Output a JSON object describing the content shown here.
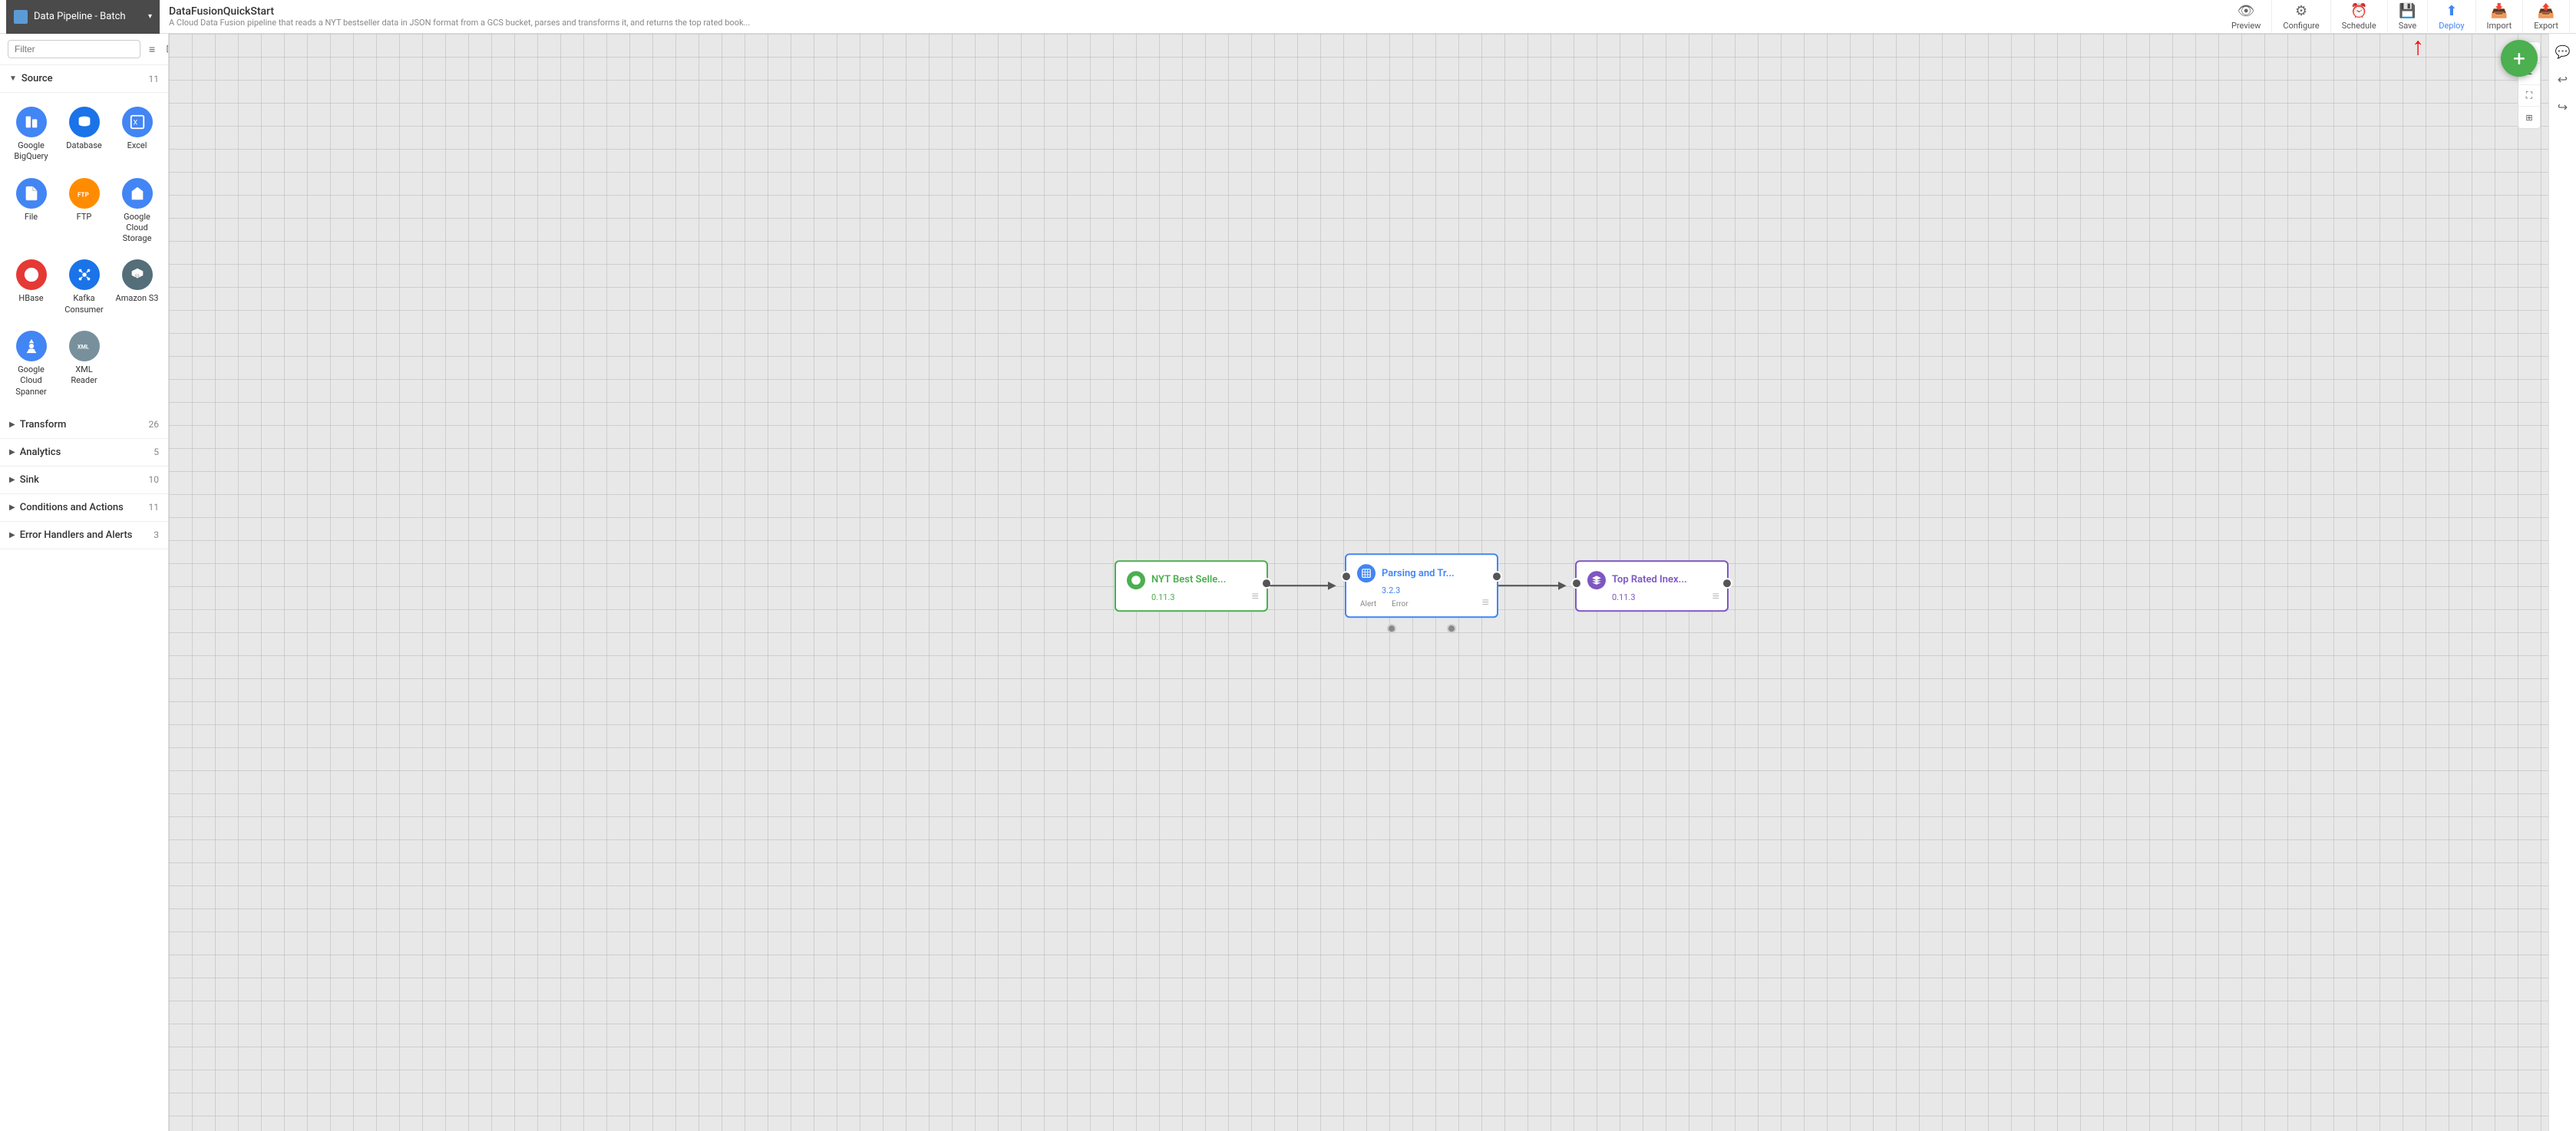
{
  "topbar": {
    "pipeline_selector": {
      "label": "Data Pipeline - Batch",
      "arrow": "▾"
    },
    "app_title": "DataFusionQuickStart",
    "app_desc": "A Cloud Data Fusion pipeline that reads a NYT bestseller data in JSON format from a GCS bucket, parses and transforms it, and returns the top rated book...",
    "toolbar_buttons": [
      {
        "id": "preview",
        "icon": "👁",
        "label": "Preview"
      },
      {
        "id": "configure",
        "icon": "⚙",
        "label": "Configure"
      },
      {
        "id": "schedule",
        "icon": "⏰",
        "label": "Schedule"
      },
      {
        "id": "save",
        "icon": "💾",
        "label": "Save"
      },
      {
        "id": "deploy",
        "icon": "⬆",
        "label": "Deploy"
      },
      {
        "id": "import",
        "icon": "📥",
        "label": "Import"
      },
      {
        "id": "export",
        "icon": "📤",
        "label": "Export"
      }
    ]
  },
  "sidebar": {
    "filter_placeholder": "Filter",
    "sections": [
      {
        "id": "source",
        "title": "Source",
        "count": "11",
        "expanded": true,
        "plugins": [
          {
            "id": "bigquery",
            "name": "Google BigQuery",
            "icon": "📊"
          },
          {
            "id": "database",
            "name": "Database",
            "icon": "🗄"
          },
          {
            "id": "excel",
            "name": "Excel",
            "icon": "📋"
          },
          {
            "id": "file",
            "name": "File",
            "icon": "📁"
          },
          {
            "id": "ftp",
            "name": "FTP",
            "icon": "🔄"
          },
          {
            "id": "gcs",
            "name": "Google Cloud Storage",
            "icon": "☁"
          },
          {
            "id": "hbase",
            "name": "HBase",
            "icon": "🦈"
          },
          {
            "id": "kafka",
            "name": "Kafka Consumer",
            "icon": "⚙"
          },
          {
            "id": "s3",
            "name": "Amazon S3",
            "icon": "☁"
          },
          {
            "id": "spanner",
            "name": "Google Cloud Spanner",
            "icon": "🔷"
          },
          {
            "id": "xml",
            "name": "XML Reader",
            "icon": "📄"
          }
        ]
      },
      {
        "id": "transform",
        "title": "Transform",
        "count": "26",
        "expanded": false,
        "plugins": []
      },
      {
        "id": "analytics",
        "title": "Analytics",
        "count": "5",
        "expanded": false,
        "plugins": []
      },
      {
        "id": "sink",
        "title": "Sink",
        "count": "10",
        "expanded": false,
        "plugins": []
      },
      {
        "id": "conditions",
        "title": "Conditions and Actions",
        "count": "11",
        "expanded": false,
        "plugins": []
      },
      {
        "id": "error_handlers",
        "title": "Error Handlers and Alerts",
        "count": "3",
        "expanded": false,
        "plugins": []
      }
    ]
  },
  "pipeline": {
    "nodes": [
      {
        "id": "source-node",
        "type": "source",
        "title": "NYT Best Selle...",
        "version": "0.11.3",
        "icon": "☁",
        "color": "green"
      },
      {
        "id": "transform-node",
        "type": "transform",
        "title": "Parsing and Tr...",
        "version": "3.2.3",
        "icon": "🔲",
        "color": "blue",
        "alert_label": "Alert",
        "error_label": "Error"
      },
      {
        "id": "sink-node",
        "type": "sink",
        "title": "Top Rated Inex...",
        "version": "0.11.3",
        "icon": "🔷",
        "color": "purple"
      }
    ]
  },
  "right_panel": {
    "buttons": [
      {
        "id": "zoom-in",
        "icon": "+"
      },
      {
        "id": "zoom-out",
        "icon": "−"
      },
      {
        "id": "fit",
        "icon": "⛶"
      },
      {
        "id": "minimap",
        "icon": "⊞"
      },
      {
        "id": "comment",
        "icon": "💬"
      },
      {
        "id": "undo",
        "icon": "↩"
      },
      {
        "id": "redo",
        "icon": "↪"
      }
    ]
  },
  "fab": {
    "label": "+"
  }
}
